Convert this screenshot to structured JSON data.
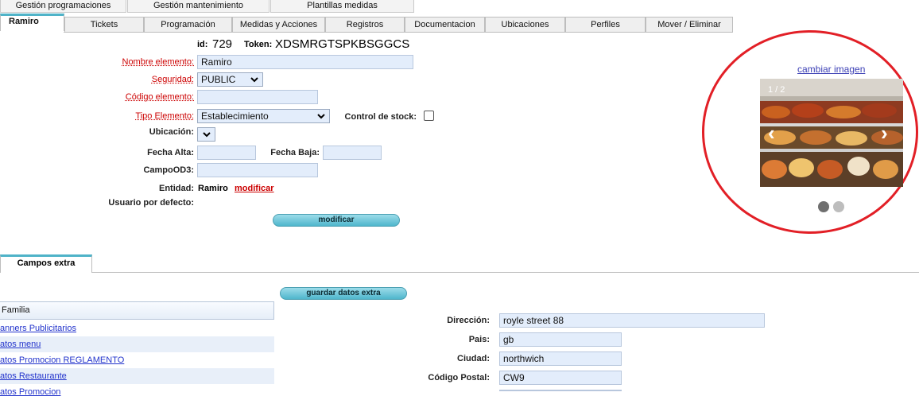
{
  "top_tabs": [
    "Gestión programaciones",
    "Gestión mantenimiento",
    "Plantillas medidas"
  ],
  "sub_tabs": [
    "Ramiro",
    "Tickets",
    "Programación",
    "Medidas y Acciones",
    "Registros",
    "Documentacion",
    "Ubicaciones",
    "Perfiles",
    "Mover / Eliminar"
  ],
  "header": {
    "id_label": "id:",
    "id_value": "729",
    "token_label": "Token:",
    "token_value": "XDSMRGTSPKBSGGCS"
  },
  "form": {
    "nombre_label": "Nombre elemento:",
    "nombre_value": "Ramiro",
    "seguridad_label": "Seguridad:",
    "seguridad_value": "PUBLIC",
    "codigo_label": "Código elemento:",
    "codigo_value": "",
    "tipo_label": "Tipo Elemento:",
    "tipo_value": "Establecimiento",
    "stock_label": "Control de stock:",
    "ubicacion_label": "Ubicación:",
    "ubicacion_value": "",
    "fecha_alta_label": "Fecha Alta:",
    "fecha_alta_value": "",
    "fecha_baja_label": "Fecha Baja:",
    "fecha_baja_value": "",
    "campo_label": "CampoOD3:",
    "campo_value": "",
    "entidad_label": "Entidad:",
    "entidad_value": "Ramiro",
    "entidad_link": "modificar",
    "usuario_label": "Usuario por defecto:",
    "submit": "modificar"
  },
  "image_panel": {
    "change_link": "cambiar imagen",
    "counter": "1 / 2",
    "prev": "‹",
    "next": "›"
  },
  "extra": {
    "tab": "Campos extra",
    "save_button": "guardar datos extra",
    "list_header": "Familia",
    "list_items": [
      "anners Publicitarios",
      "atos menu",
      "atos Promocion REGLAMENTO",
      "atos Restaurante",
      "atos Promocion"
    ],
    "fields": [
      {
        "label": "Dirección:",
        "value": "royle street 88"
      },
      {
        "label": "Pais:",
        "value": "gb"
      },
      {
        "label": "Ciudad:",
        "value": "northwich"
      },
      {
        "label": "Código Postal:",
        "value": "CW9"
      }
    ]
  }
}
